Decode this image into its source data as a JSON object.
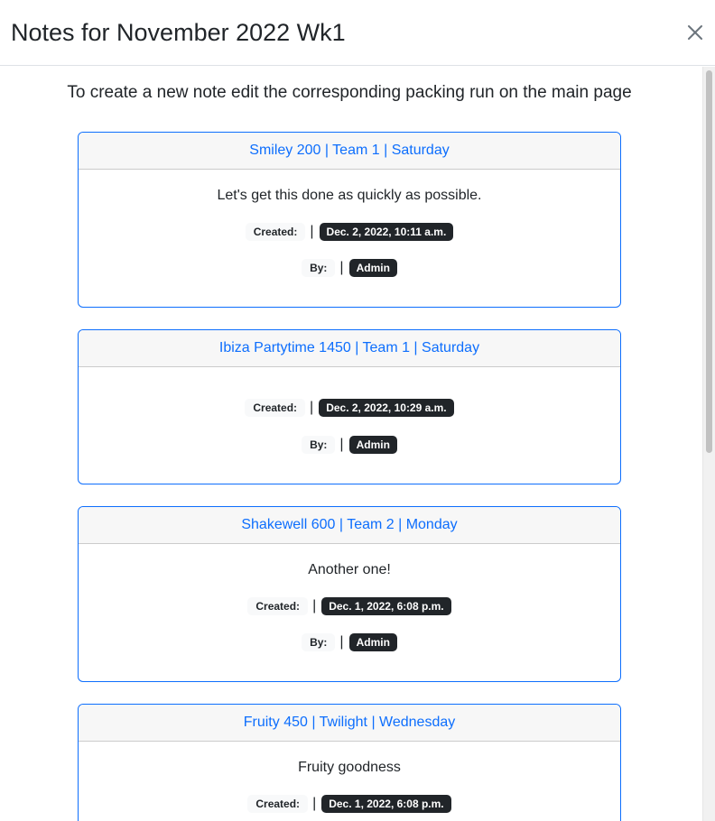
{
  "modal": {
    "title": "Notes for November 2022 Wk1",
    "close_icon": "close-icon"
  },
  "instructions": "To create a new note edit the corresponding packing run on the main page",
  "labels": {
    "created": "Created:",
    "by": "By:",
    "separator": "|"
  },
  "notes": [
    {
      "heading": "Smiley 200 | Team 1 | Saturday",
      "text": "Let's get this done as quickly as possible.",
      "created": "Dec. 2, 2022, 10:11 a.m.",
      "by": "Admin"
    },
    {
      "heading": "Ibiza Partytime 1450 | Team 1 | Saturday",
      "text": "",
      "created": "Dec. 2, 2022, 10:29 a.m.",
      "by": "Admin"
    },
    {
      "heading": "Shakewell 600 | Team 2 | Monday",
      "text": "Another one!",
      "created": "Dec. 1, 2022, 6:08 p.m.",
      "by": "Admin"
    },
    {
      "heading": "Fruity 450 | Twilight | Wednesday",
      "text": "Fruity goodness",
      "created": "Dec. 1, 2022, 6:08 p.m.",
      "by": ""
    }
  ],
  "colors": {
    "link": "#0d6efd",
    "badge_bg": "#212529",
    "card_border": "#0d6efd",
    "header_bg": "#f7f7f7"
  }
}
